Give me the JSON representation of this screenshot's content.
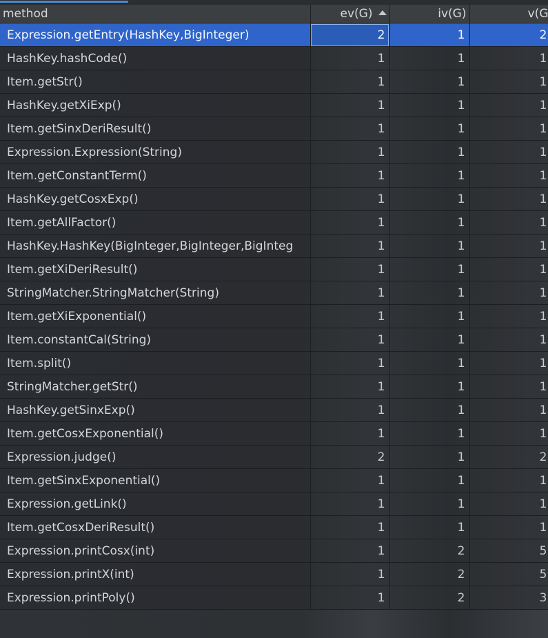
{
  "table": {
    "columns": [
      {
        "key": "method",
        "label": "method"
      },
      {
        "key": "ev",
        "label": "ev(G)"
      },
      {
        "key": "iv",
        "label": "iv(G)"
      },
      {
        "key": "v",
        "label": "v(G"
      }
    ],
    "sort": {
      "column": "ev",
      "direction": "ascending"
    },
    "selected_row": 0,
    "rows": [
      {
        "method": "Expression.getEntry(HashKey,BigInteger)",
        "ev": "2",
        "iv": "1",
        "v": "2"
      },
      {
        "method": "HashKey.hashCode()",
        "ev": "1",
        "iv": "1",
        "v": "1"
      },
      {
        "method": "Item.getStr()",
        "ev": "1",
        "iv": "1",
        "v": "1"
      },
      {
        "method": "HashKey.getXiExp()",
        "ev": "1",
        "iv": "1",
        "v": "1"
      },
      {
        "method": "Item.getSinxDeriResult()",
        "ev": "1",
        "iv": "1",
        "v": "1"
      },
      {
        "method": "Expression.Expression(String)",
        "ev": "1",
        "iv": "1",
        "v": "1"
      },
      {
        "method": "Item.getConstantTerm()",
        "ev": "1",
        "iv": "1",
        "v": "1"
      },
      {
        "method": "HashKey.getCosxExp()",
        "ev": "1",
        "iv": "1",
        "v": "1"
      },
      {
        "method": "Item.getAllFactor()",
        "ev": "1",
        "iv": "1",
        "v": "1"
      },
      {
        "method": "HashKey.HashKey(BigInteger,BigInteger,BigInteg",
        "ev": "1",
        "iv": "1",
        "v": "1"
      },
      {
        "method": "Item.getXiDeriResult()",
        "ev": "1",
        "iv": "1",
        "v": "1"
      },
      {
        "method": "StringMatcher.StringMatcher(String)",
        "ev": "1",
        "iv": "1",
        "v": "1"
      },
      {
        "method": "Item.getXiExponential()",
        "ev": "1",
        "iv": "1",
        "v": "1"
      },
      {
        "method": "Item.constantCal(String)",
        "ev": "1",
        "iv": "1",
        "v": "1"
      },
      {
        "method": "Item.split()",
        "ev": "1",
        "iv": "1",
        "v": "1"
      },
      {
        "method": "StringMatcher.getStr()",
        "ev": "1",
        "iv": "1",
        "v": "1"
      },
      {
        "method": "HashKey.getSinxExp()",
        "ev": "1",
        "iv": "1",
        "v": "1"
      },
      {
        "method": "Item.getCosxExponential()",
        "ev": "1",
        "iv": "1",
        "v": "1"
      },
      {
        "method": "Expression.judge()",
        "ev": "2",
        "iv": "1",
        "v": "2"
      },
      {
        "method": "Item.getSinxExponential()",
        "ev": "1",
        "iv": "1",
        "v": "1"
      },
      {
        "method": "Expression.getLink()",
        "ev": "1",
        "iv": "1",
        "v": "1"
      },
      {
        "method": "Item.getCosxDeriResult()",
        "ev": "1",
        "iv": "1",
        "v": "1"
      },
      {
        "method": "Expression.printCosx(int)",
        "ev": "1",
        "iv": "2",
        "v": "5"
      },
      {
        "method": "Expression.printX(int)",
        "ev": "1",
        "iv": "2",
        "v": "5"
      },
      {
        "method": "Expression.printPoly()",
        "ev": "1",
        "iv": "2",
        "v": "3"
      }
    ]
  },
  "colors": {
    "selection": "#2f65ca",
    "header_bg": "#3c3f41",
    "accent": "#4a88c7"
  }
}
